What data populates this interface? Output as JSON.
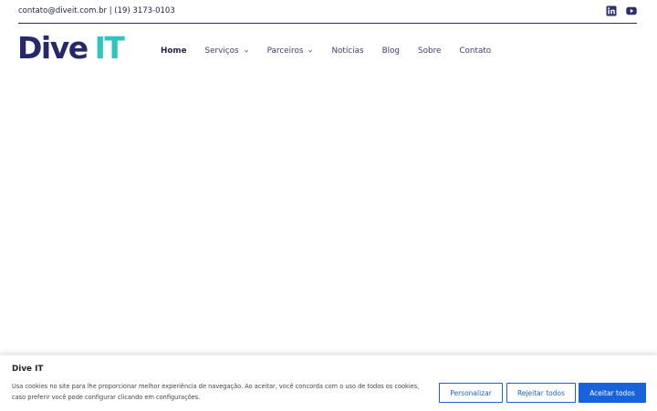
{
  "header": {
    "contact_text": "contato@diveit.com.br | (19) 3173-0103",
    "social": [
      {
        "icon": "linkedin-icon"
      },
      {
        "icon": "youtube-icon"
      }
    ]
  },
  "logo": {
    "part1": "Dive",
    "part2": "IT",
    "colors": {
      "part1": "#25296b",
      "part2": "#2ec4bf"
    }
  },
  "nav": {
    "items": [
      {
        "label": "Home",
        "active": true
      },
      {
        "label": "Serviços",
        "dropdown": true
      },
      {
        "label": "Parceiros",
        "dropdown": true
      },
      {
        "label": "Notícias"
      },
      {
        "label": "Blog"
      },
      {
        "label": "Sobre"
      },
      {
        "label": "Contato"
      }
    ]
  },
  "cookie_banner": {
    "title": "Dive IT",
    "description": "Usa cookies no site para lhe proporcionar melhor experiência de navegação. Ao aceitar, você concorda com o uso de todos os cookies, caso preferir você pode configurar clicando em configurações.",
    "buttons": {
      "customize": "Personalizar",
      "reject": "Rejeitar todos",
      "accept": "Aceitar todos"
    },
    "accent_color": "#1863dc"
  }
}
